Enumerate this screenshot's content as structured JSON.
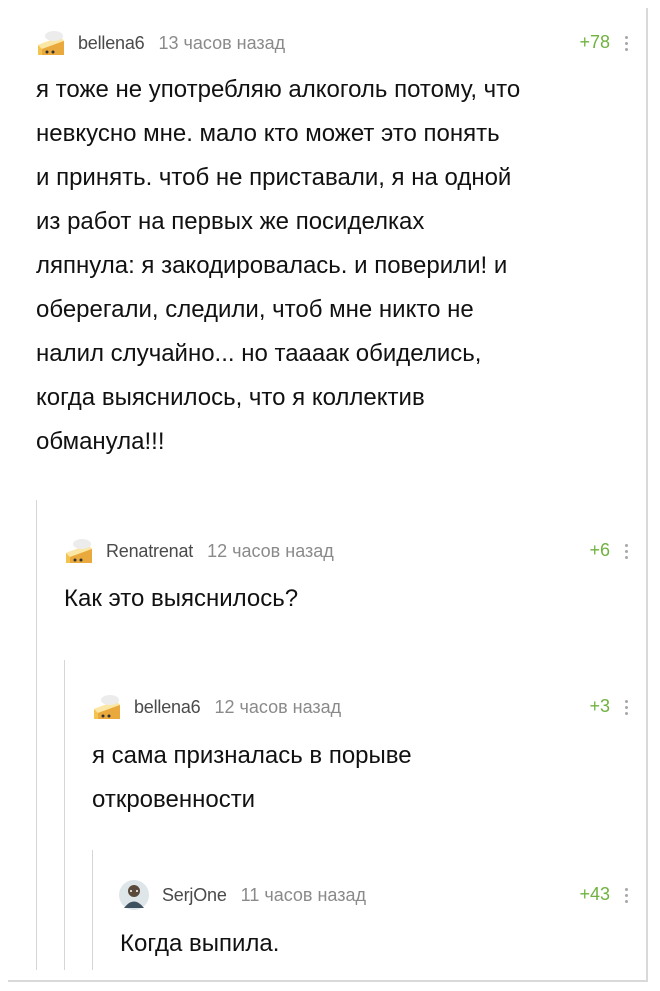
{
  "comments": [
    {
      "username": "bellena6",
      "time": "13 часов назад",
      "rating": "+78",
      "avatar_icon": "cake-slice-icon",
      "text": "я тоже не употребляю алкоголь потому, что\nневкусно мне. мало кто может это понять\nи принять. чтоб не приставали, я на одной\nиз работ на первых же посиделках\nляпнула: я закодировалась. и поверили! и\nоберегали, следили, чтоб мне никто не\nналил случайно... но таааак обиделись,\nкогда выяснилось, что я коллектив\nобманула!!!"
    },
    {
      "username": "Renatrenat",
      "time": "12 часов назад",
      "rating": "+6",
      "avatar_icon": "cake-slice-icon",
      "text": "Как это выяснилось?"
    },
    {
      "username": "bellena6",
      "time": "12 часов назад",
      "rating": "+3",
      "avatar_icon": "cake-slice-icon",
      "text": "я сама призналась в порыве\nоткровенности"
    },
    {
      "username": "SerjOne",
      "time": "11 часов назад",
      "rating": "+43",
      "avatar_icon": "user-photo-icon",
      "text": "Когда выпила."
    }
  ],
  "colors": {
    "rating": "#6fb23f",
    "username": "#4a4a4a",
    "time": "#8a8a8a",
    "thread_line": "#d6d6d6"
  }
}
